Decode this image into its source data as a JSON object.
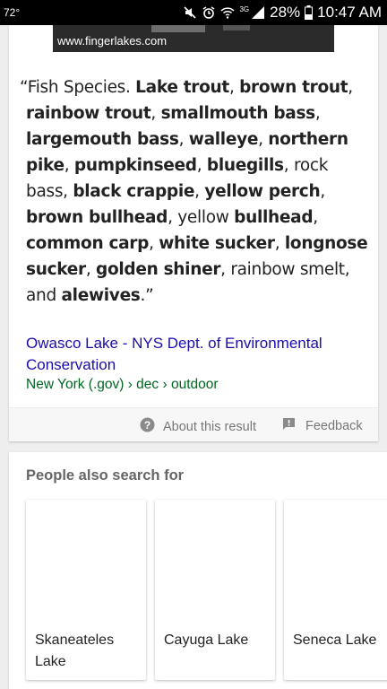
{
  "status_bar": {
    "temperature": "72°",
    "network": "3G",
    "battery_percent": "28%",
    "time": "10:47 AM"
  },
  "image": {
    "caption": "www.fingerlakes.com"
  },
  "snippet": {
    "open_quote": "“",
    "lines": [
      [
        {
          "t": "Fish Species. ",
          "b": false
        },
        {
          "t": "Lake trout",
          "b": true
        },
        {
          "t": ", ",
          "b": false
        },
        {
          "t": "brown trout",
          "b": true
        },
        {
          "t": ",",
          "b": false
        }
      ],
      [
        {
          "t": "rainbow trout",
          "b": true
        },
        {
          "t": ", ",
          "b": false
        },
        {
          "t": "smallmouth bass",
          "b": true
        },
        {
          "t": ",",
          "b": false
        }
      ],
      [
        {
          "t": "largemouth bass",
          "b": true
        },
        {
          "t": ", ",
          "b": false
        },
        {
          "t": "walleye",
          "b": true
        },
        {
          "t": ", ",
          "b": false
        },
        {
          "t": "northern",
          "b": true
        }
      ],
      [
        {
          "t": "pike",
          "b": true
        },
        {
          "t": ", ",
          "b": false
        },
        {
          "t": "pumpkinseed",
          "b": true
        },
        {
          "t": ", ",
          "b": false
        },
        {
          "t": "bluegills",
          "b": true
        },
        {
          "t": ", rock",
          "b": false
        }
      ],
      [
        {
          "t": "bass, ",
          "b": false
        },
        {
          "t": "black crappie",
          "b": true
        },
        {
          "t": ", ",
          "b": false
        },
        {
          "t": "yellow perch",
          "b": true
        },
        {
          "t": ",",
          "b": false
        }
      ],
      [
        {
          "t": "brown bullhead",
          "b": true
        },
        {
          "t": ", yellow ",
          "b": false
        },
        {
          "t": "bullhead",
          "b": true
        },
        {
          "t": ",",
          "b": false
        }
      ],
      [
        {
          "t": "common carp",
          "b": true
        },
        {
          "t": ", ",
          "b": false
        },
        {
          "t": "white sucker",
          "b": true
        },
        {
          "t": ", ",
          "b": false
        },
        {
          "t": "longnose",
          "b": true
        }
      ],
      [
        {
          "t": "sucker",
          "b": true
        },
        {
          "t": ", ",
          "b": false
        },
        {
          "t": "golden shiner",
          "b": true
        },
        {
          "t": ", rainbow smelt,",
          "b": false
        }
      ],
      [
        {
          "t": "and ",
          "b": false
        },
        {
          "t": "alewives",
          "b": true
        },
        {
          "t": ".”",
          "b": false
        }
      ]
    ]
  },
  "source": {
    "title": "Owasco Lake - NYS Dept. of Environmental Conservation",
    "url": "New York (.gov) › dec › outdoor"
  },
  "footer": {
    "about_label": "About this result",
    "feedback_label": "Feedback"
  },
  "people_also_search": {
    "title": "People also search for",
    "items": [
      {
        "label": "Skaneateles Lake"
      },
      {
        "label": "Cayuga Lake"
      },
      {
        "label": "Seneca Lake"
      }
    ]
  },
  "colors": {
    "link": "#1a0dab",
    "url": "#006621",
    "status_bar_bg": "#000000"
  }
}
